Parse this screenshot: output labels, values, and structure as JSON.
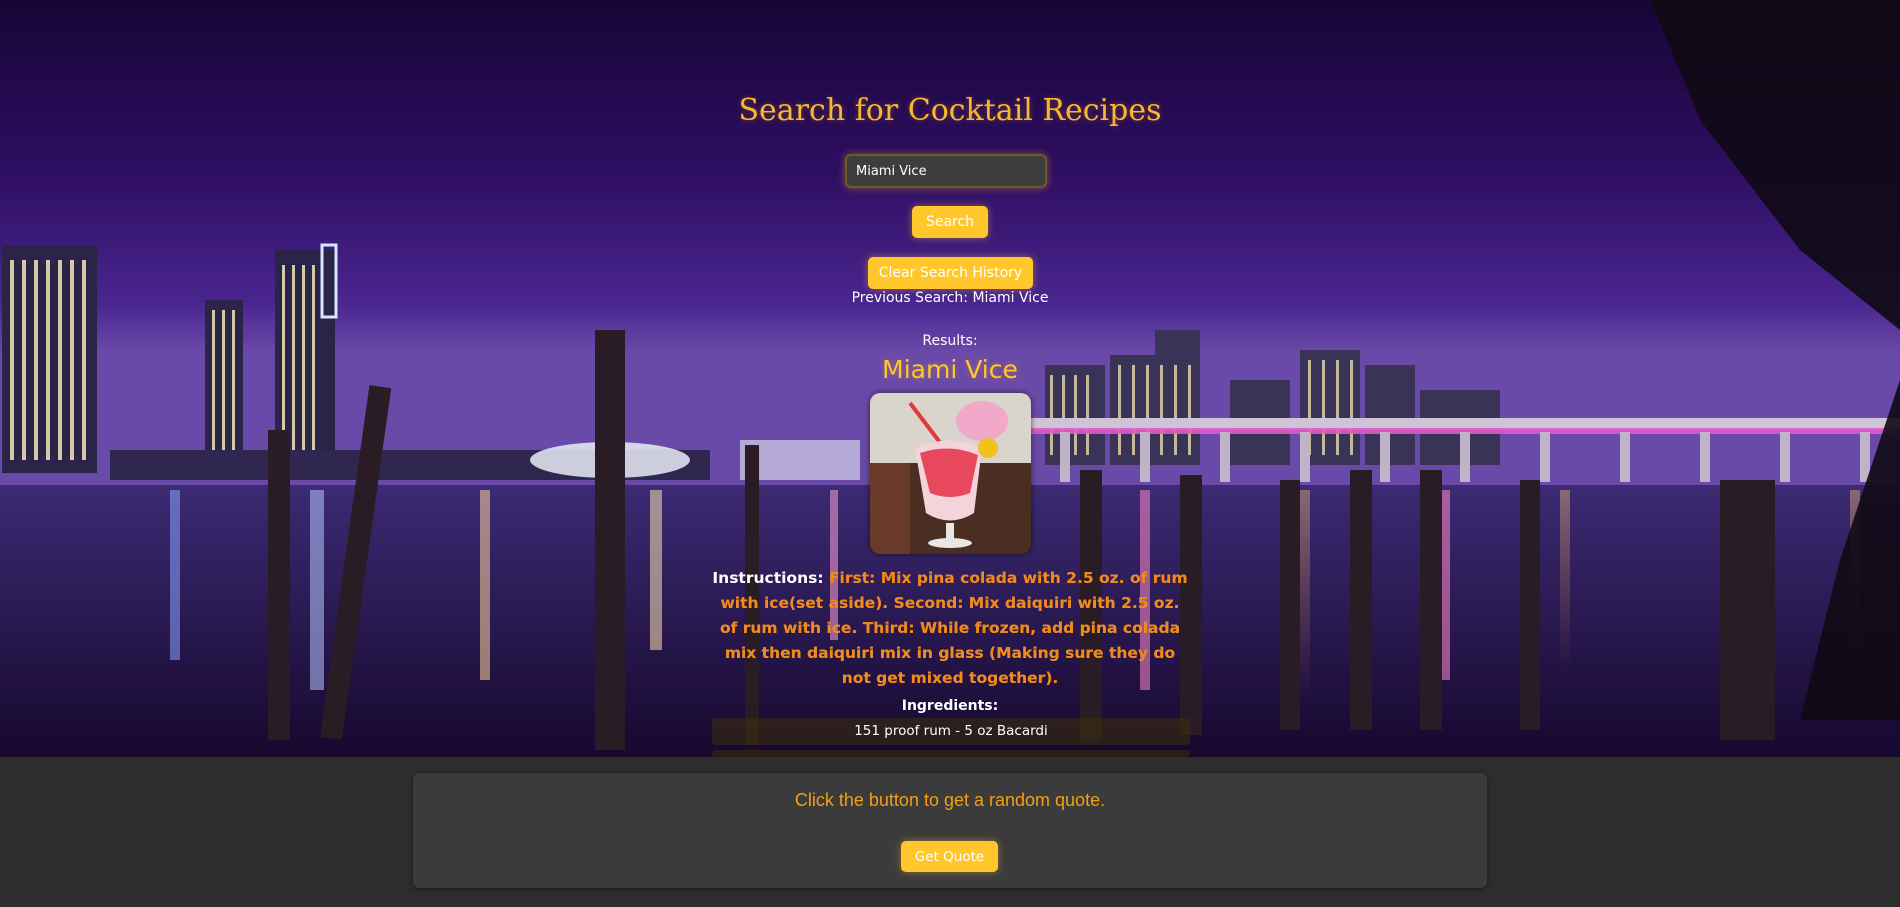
{
  "search": {
    "title": "Search for Cocktail Recipes",
    "input_value": "Miami Vice",
    "search_label": "Search",
    "clear_label": "Clear Search History",
    "previous_search": "Previous Search: Miami Vice"
  },
  "results": {
    "label": "Results:",
    "drink_name": "Miami Vice",
    "instructions_label": "Instructions:",
    "instructions_text": "First: Mix pina colada with 2.5 oz. of rum with ice(set aside). Second: Mix daiquiri with 2.5 oz. of rum with ice. Third: While frozen, add pina colada mix then daiquiri mix in glass (Making sure they do not get mixed together).",
    "ingredients_label": "Ingredients:",
    "ingredients": [
      "151 proof rum - 5 oz Bacardi"
    ]
  },
  "quote": {
    "text": "Click the button to get a random quote.",
    "button_label": "Get Quote"
  },
  "colors": {
    "accent": "#ffc72c",
    "title": "#f5b82e",
    "quote_text": "#f0a012",
    "footer_bg": "#2d2d2d",
    "card_bg": "#3b3b3b"
  }
}
